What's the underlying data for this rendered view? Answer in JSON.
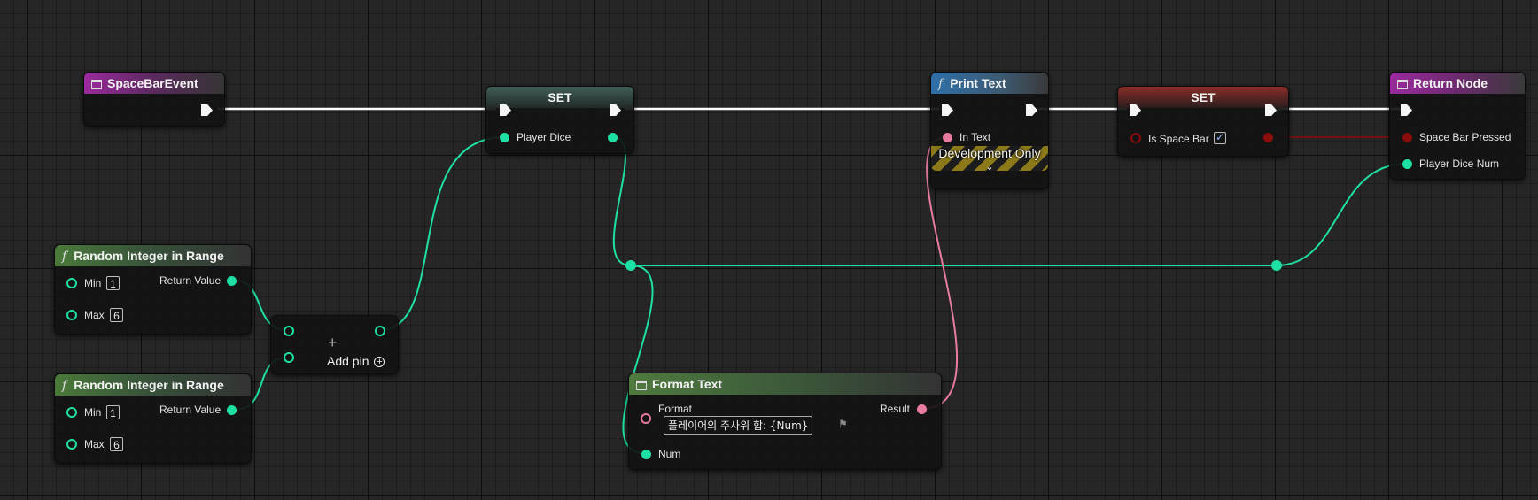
{
  "colors": {
    "exec": "#ffffff",
    "integer": "#1fe0a4",
    "text": "#e87ca0",
    "boolean": "#8a0d0d"
  },
  "nodes": {
    "spacebar_event": {
      "title": "SpaceBarEvent",
      "icon": "event-icon"
    },
    "set_dice": {
      "title": "SET",
      "var_label": "Player Dice"
    },
    "print_text": {
      "title": "Print Text",
      "icon": "function-icon",
      "in_text_label": "In Text",
      "dev_label": "Development Only",
      "chevron": "⌄"
    },
    "set_space": {
      "title": "SET",
      "var_label": "Is Space Bar",
      "checked": true,
      "check_glyph": "✓"
    },
    "return_node": {
      "title": "Return Node",
      "pin1_label": "Space Bar Pressed",
      "pin2_label": "Player Dice Num"
    },
    "random1": {
      "title": "Random Integer in Range",
      "min_label": "Min",
      "min_value": "1",
      "max_label": "Max",
      "max_value": "6",
      "return_label": "Return Value"
    },
    "random2": {
      "title": "Random Integer in Range",
      "min_label": "Min",
      "min_value": "1",
      "max_label": "Max",
      "max_value": "6",
      "return_label": "Return Value"
    },
    "add": {
      "add_pin_label": "Add pin",
      "plus_glyph": "+"
    },
    "format_text": {
      "title": "Format Text",
      "format_label": "Format",
      "format_value": "플레이어의 주사위 합: {Num}",
      "result_label": "Result",
      "num_label": "Num",
      "flag_glyph": "⚑"
    }
  }
}
